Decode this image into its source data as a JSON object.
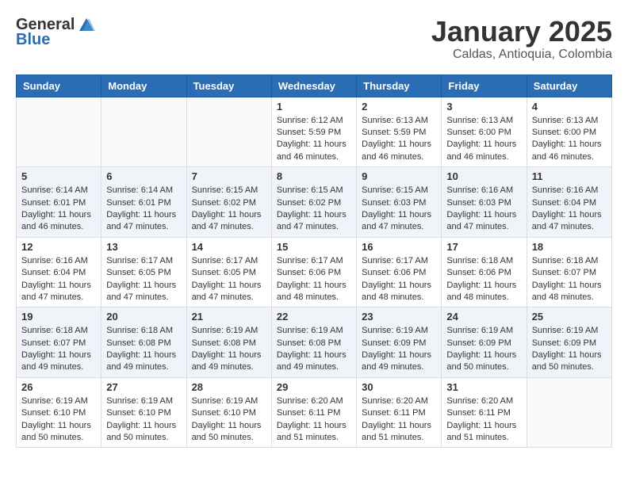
{
  "header": {
    "logo_general": "General",
    "logo_blue": "Blue",
    "month_title": "January 2025",
    "location": "Caldas, Antioquia, Colombia"
  },
  "weekdays": [
    "Sunday",
    "Monday",
    "Tuesday",
    "Wednesday",
    "Thursday",
    "Friday",
    "Saturday"
  ],
  "weeks": [
    [
      {
        "day": "",
        "info": ""
      },
      {
        "day": "",
        "info": ""
      },
      {
        "day": "",
        "info": ""
      },
      {
        "day": "1",
        "info": "Sunrise: 6:12 AM\nSunset: 5:59 PM\nDaylight: 11 hours and 46 minutes."
      },
      {
        "day": "2",
        "info": "Sunrise: 6:13 AM\nSunset: 5:59 PM\nDaylight: 11 hours and 46 minutes."
      },
      {
        "day": "3",
        "info": "Sunrise: 6:13 AM\nSunset: 6:00 PM\nDaylight: 11 hours and 46 minutes."
      },
      {
        "day": "4",
        "info": "Sunrise: 6:13 AM\nSunset: 6:00 PM\nDaylight: 11 hours and 46 minutes."
      }
    ],
    [
      {
        "day": "5",
        "info": "Sunrise: 6:14 AM\nSunset: 6:01 PM\nDaylight: 11 hours and 46 minutes."
      },
      {
        "day": "6",
        "info": "Sunrise: 6:14 AM\nSunset: 6:01 PM\nDaylight: 11 hours and 47 minutes."
      },
      {
        "day": "7",
        "info": "Sunrise: 6:15 AM\nSunset: 6:02 PM\nDaylight: 11 hours and 47 minutes."
      },
      {
        "day": "8",
        "info": "Sunrise: 6:15 AM\nSunset: 6:02 PM\nDaylight: 11 hours and 47 minutes."
      },
      {
        "day": "9",
        "info": "Sunrise: 6:15 AM\nSunset: 6:03 PM\nDaylight: 11 hours and 47 minutes."
      },
      {
        "day": "10",
        "info": "Sunrise: 6:16 AM\nSunset: 6:03 PM\nDaylight: 11 hours and 47 minutes."
      },
      {
        "day": "11",
        "info": "Sunrise: 6:16 AM\nSunset: 6:04 PM\nDaylight: 11 hours and 47 minutes."
      }
    ],
    [
      {
        "day": "12",
        "info": "Sunrise: 6:16 AM\nSunset: 6:04 PM\nDaylight: 11 hours and 47 minutes."
      },
      {
        "day": "13",
        "info": "Sunrise: 6:17 AM\nSunset: 6:05 PM\nDaylight: 11 hours and 47 minutes."
      },
      {
        "day": "14",
        "info": "Sunrise: 6:17 AM\nSunset: 6:05 PM\nDaylight: 11 hours and 47 minutes."
      },
      {
        "day": "15",
        "info": "Sunrise: 6:17 AM\nSunset: 6:06 PM\nDaylight: 11 hours and 48 minutes."
      },
      {
        "day": "16",
        "info": "Sunrise: 6:17 AM\nSunset: 6:06 PM\nDaylight: 11 hours and 48 minutes."
      },
      {
        "day": "17",
        "info": "Sunrise: 6:18 AM\nSunset: 6:06 PM\nDaylight: 11 hours and 48 minutes."
      },
      {
        "day": "18",
        "info": "Sunrise: 6:18 AM\nSunset: 6:07 PM\nDaylight: 11 hours and 48 minutes."
      }
    ],
    [
      {
        "day": "19",
        "info": "Sunrise: 6:18 AM\nSunset: 6:07 PM\nDaylight: 11 hours and 49 minutes."
      },
      {
        "day": "20",
        "info": "Sunrise: 6:18 AM\nSunset: 6:08 PM\nDaylight: 11 hours and 49 minutes."
      },
      {
        "day": "21",
        "info": "Sunrise: 6:19 AM\nSunset: 6:08 PM\nDaylight: 11 hours and 49 minutes."
      },
      {
        "day": "22",
        "info": "Sunrise: 6:19 AM\nSunset: 6:08 PM\nDaylight: 11 hours and 49 minutes."
      },
      {
        "day": "23",
        "info": "Sunrise: 6:19 AM\nSunset: 6:09 PM\nDaylight: 11 hours and 49 minutes."
      },
      {
        "day": "24",
        "info": "Sunrise: 6:19 AM\nSunset: 6:09 PM\nDaylight: 11 hours and 50 minutes."
      },
      {
        "day": "25",
        "info": "Sunrise: 6:19 AM\nSunset: 6:09 PM\nDaylight: 11 hours and 50 minutes."
      }
    ],
    [
      {
        "day": "26",
        "info": "Sunrise: 6:19 AM\nSunset: 6:10 PM\nDaylight: 11 hours and 50 minutes."
      },
      {
        "day": "27",
        "info": "Sunrise: 6:19 AM\nSunset: 6:10 PM\nDaylight: 11 hours and 50 minutes."
      },
      {
        "day": "28",
        "info": "Sunrise: 6:19 AM\nSunset: 6:10 PM\nDaylight: 11 hours and 50 minutes."
      },
      {
        "day": "29",
        "info": "Sunrise: 6:20 AM\nSunset: 6:11 PM\nDaylight: 11 hours and 51 minutes."
      },
      {
        "day": "30",
        "info": "Sunrise: 6:20 AM\nSunset: 6:11 PM\nDaylight: 11 hours and 51 minutes."
      },
      {
        "day": "31",
        "info": "Sunrise: 6:20 AM\nSunset: 6:11 PM\nDaylight: 11 hours and 51 minutes."
      },
      {
        "day": "",
        "info": ""
      }
    ]
  ]
}
